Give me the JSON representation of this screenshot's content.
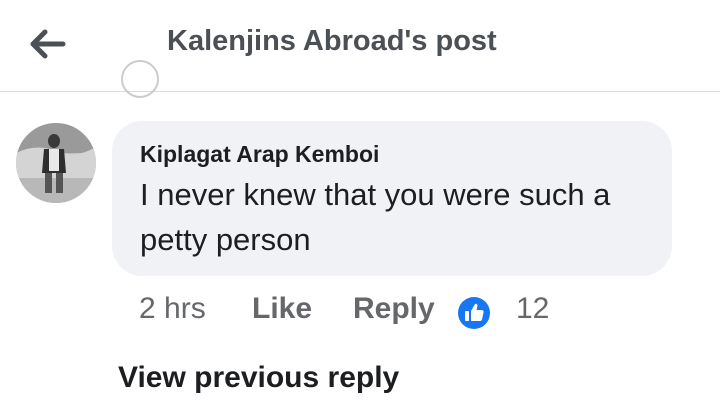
{
  "header": {
    "title": "Kalenjins Abroad's post",
    "back_icon": "arrow-left-icon"
  },
  "comment": {
    "author": "Kiplagat Arap Kemboi",
    "text": "I never knew that you were such a petty person",
    "time": "2 hrs",
    "like_label": "Like",
    "reply_label": "Reply",
    "reaction_icon": "thumbs-up-icon",
    "reaction_count": "12"
  },
  "view_previous_label": "View previous reply",
  "colors": {
    "bubble": "#f0f2f5",
    "reaction_blue": "#1877f2",
    "secondary_text": "#65676b"
  }
}
